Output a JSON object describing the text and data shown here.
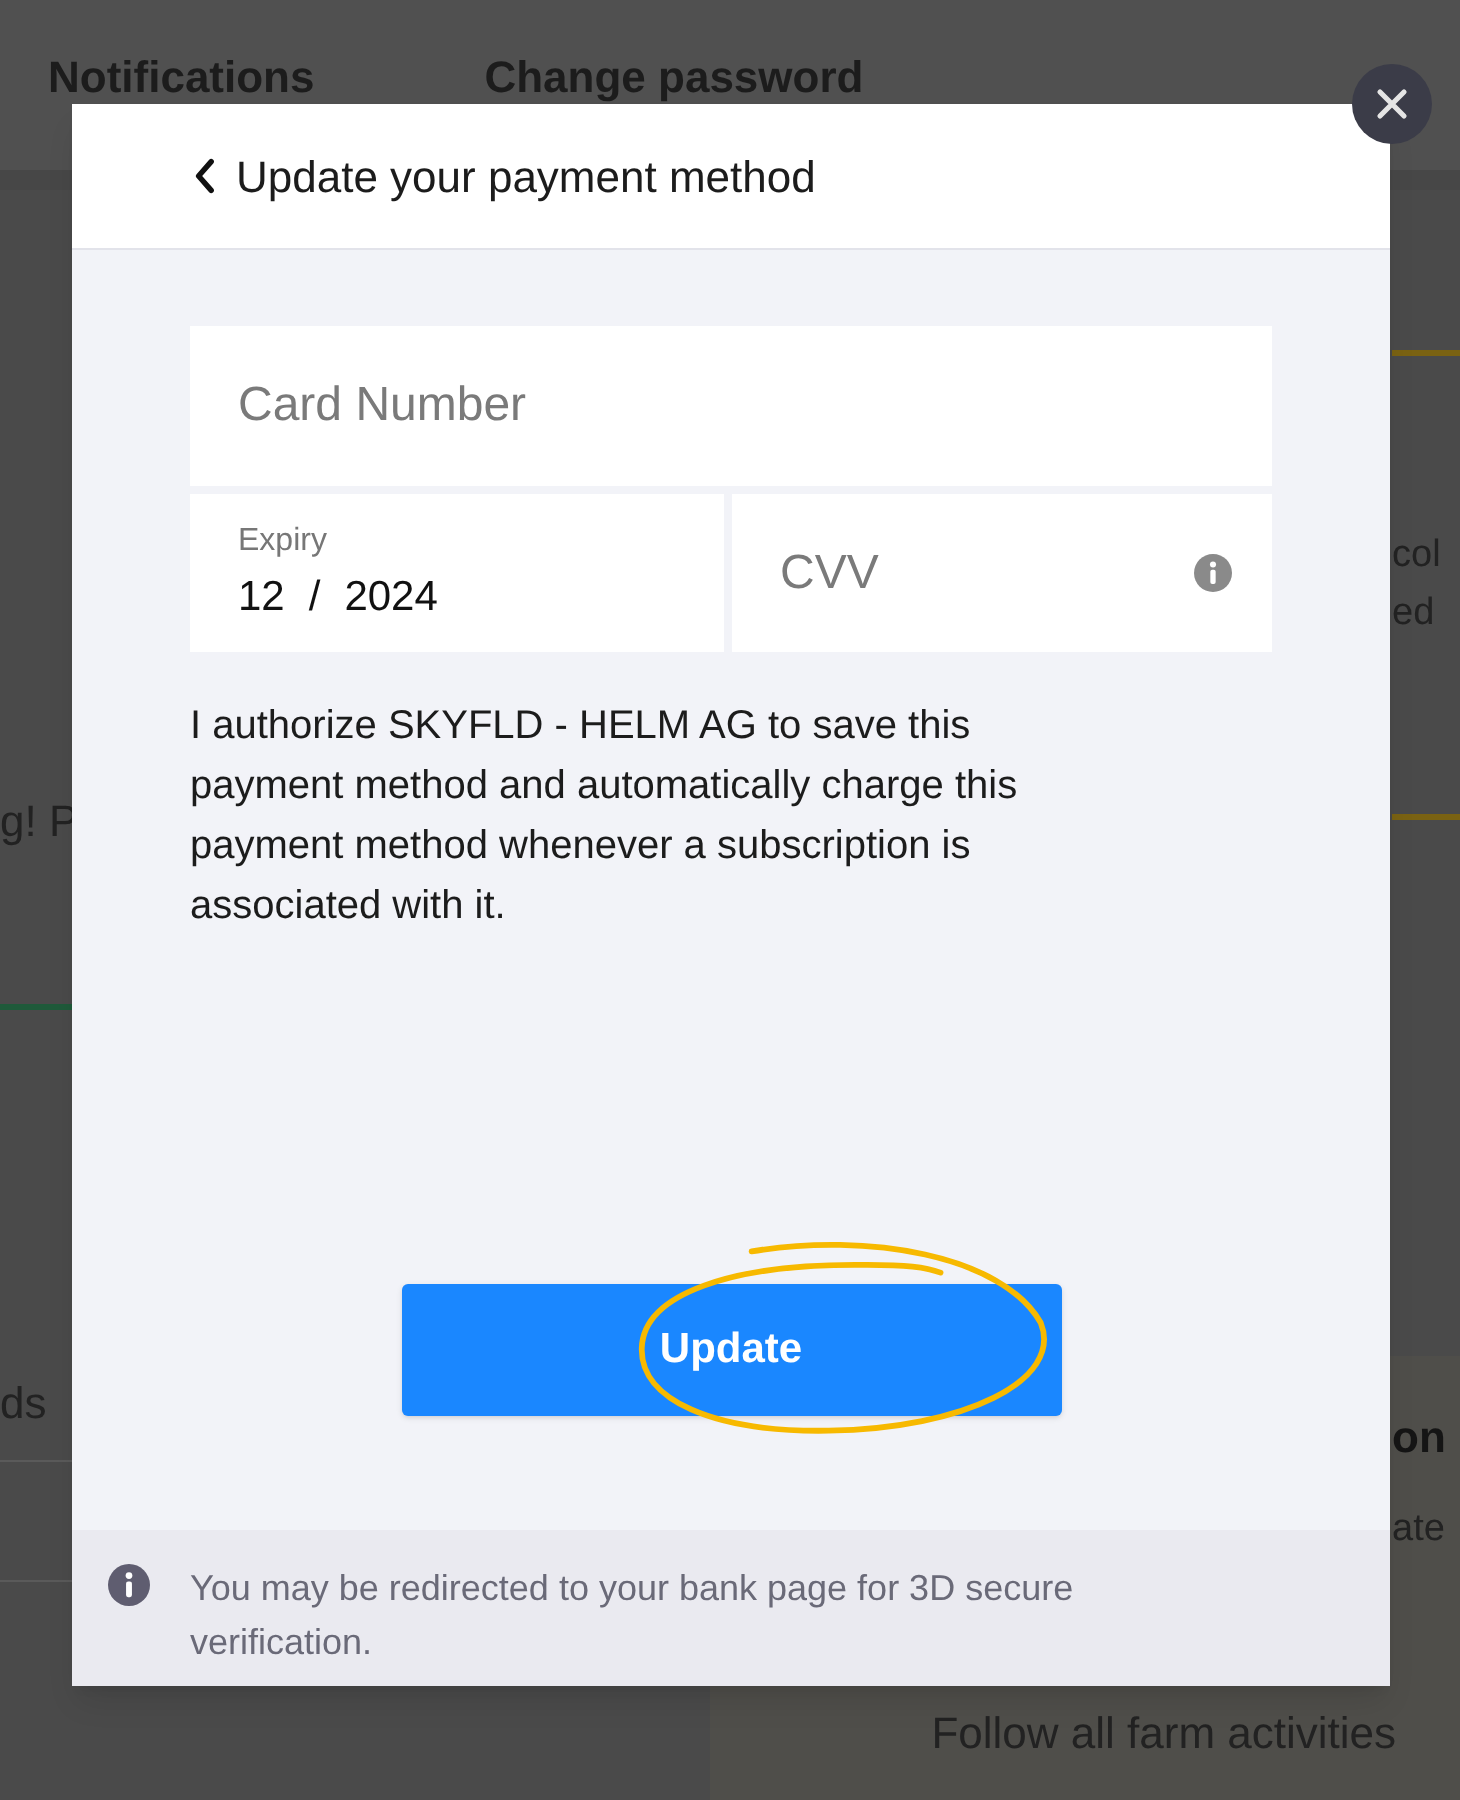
{
  "background": {
    "tabs": [
      {
        "label": "Notifications"
      },
      {
        "label": "Change password"
      }
    ],
    "left_fragments": [
      "g! P",
      "ds"
    ],
    "right_fragments": [
      "col",
      "ed"
    ],
    "card": {
      "heading": "on",
      "text": "ate",
      "caption": "Follow all farm activities"
    }
  },
  "modal": {
    "title": "Update your payment method",
    "card_number": {
      "placeholder": "Card Number"
    },
    "expiry": {
      "label": "Expiry",
      "month": "12",
      "separator": "/",
      "year": "2024"
    },
    "cvv": {
      "placeholder": "CVV"
    },
    "consent": "I authorize SKYFLD - HELM AG to save this payment method and automatically charge this payment method whenever a subscription is associated with it.",
    "button": "Update",
    "notice": "You may be redirected to your bank page for 3D secure verification."
  }
}
